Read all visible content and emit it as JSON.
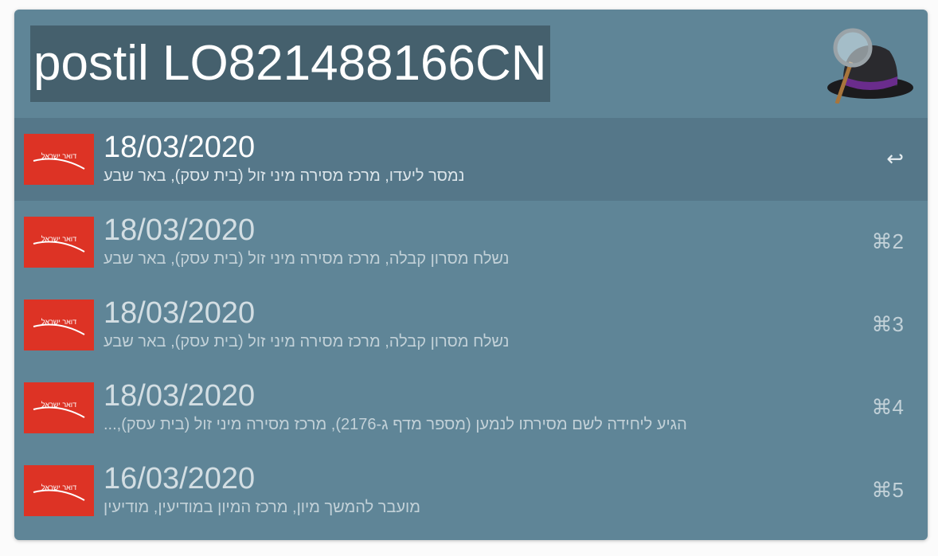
{
  "search": {
    "query": "postil LO821488166CN"
  },
  "app": {
    "logo_icon": "alfred-hat-icon"
  },
  "results": [
    {
      "title": "18/03/2020",
      "subtitle": "נמסר ליעדו, מרכז מסירה מיני זול (בית עסק), באר שבע",
      "shortcut": "↩",
      "logo_text": "דואר ישראל"
    },
    {
      "title": "18/03/2020",
      "subtitle": "נשלח מסרון קבלה, מרכז מסירה מיני זול (בית עסק), באר שבע",
      "shortcut": "⌘2",
      "logo_text": "דואר ישראל"
    },
    {
      "title": "18/03/2020",
      "subtitle": "נשלח מסרון קבלה, מרכז מסירה מיני זול (בית עסק), באר שבע",
      "shortcut": "⌘3",
      "logo_text": "דואר ישראל"
    },
    {
      "title": "18/03/2020",
      "subtitle": "הגיע ליחידה לשם מסירתו לנמען (מספר מדף ג-2176), מרכז מסירה מיני זול (בית עסק),...",
      "shortcut": "⌘4",
      "logo_text": "דואר ישראל"
    },
    {
      "title": "16/03/2020",
      "subtitle": "מועבר להמשך מיון, מרכז המיון במודיעין, מודיעין",
      "shortcut": "⌘5",
      "logo_text": "דואר ישראל"
    }
  ]
}
